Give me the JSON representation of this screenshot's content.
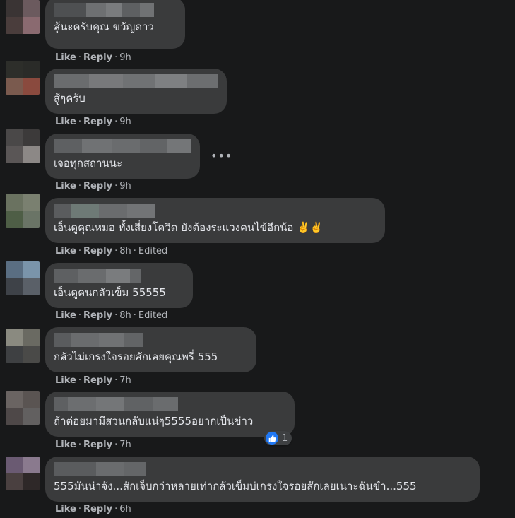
{
  "labels": {
    "like": "Like",
    "reply": "Reply",
    "separator": "·",
    "edited": "Edited"
  },
  "comments": [
    {
      "text": "สู้นะครับคุณ ขวัญดาว",
      "time": "9h",
      "edited": false,
      "avatar_colors": [
        "#3a3434",
        "#6b5a5e",
        "#4a3d3c",
        "#8a6a70"
      ],
      "name_blur_colors": [
        "#5a5c5e",
        "#6e7072",
        "#7a7c7e",
        "#5e6062",
        "#707274"
      ]
    },
    {
      "text": "สู้ๆครับ",
      "time": "9h",
      "edited": false,
      "avatar_colors": [
        "#2d2e2a",
        "#2a2b28",
        "#7a5a4e",
        "#8a4a3e"
      ],
      "name_blur_colors": [
        "#6a6c6e",
        "#78797b",
        "#707274",
        "#7e8082",
        "#6c6e70"
      ]
    },
    {
      "text": "เจอทุกสถานนะ",
      "time": "9h",
      "edited": false,
      "avatar_colors": [
        "#4a4848",
        "#3c3a3a",
        "#5a5656",
        "#8c8886"
      ],
      "name_blur_colors": [
        "#5e6062",
        "#707274",
        "#6a6c6e",
        "#626466",
        "#747678"
      ]
    },
    {
      "text": "เอ็นดูคุณหมอ ทั้งเสี่ยงโควิด ยังต้องระแวงคนไข้อีกน้อ ✌️✌️",
      "time": "8h",
      "edited": true,
      "avatar_colors": [
        "#6a7260",
        "#7a8070",
        "#4e5e46",
        "#6a7466"
      ],
      "name_blur_colors": [
        "#5a5c5e",
        "#6e7a76",
        "#6a6c6e",
        "#727476"
      ]
    },
    {
      "text": "เอ็นดูคนกลัวเข็ม 55555",
      "time": "8h",
      "edited": true,
      "avatar_colors": [
        "#5a6e82",
        "#7a94aa",
        "#3e4248",
        "#5a6068"
      ],
      "name_blur_colors": [
        "#5e6062",
        "#6a6c6e",
        "#7a7c7e",
        "#646668"
      ]
    },
    {
      "text": "กลัวไม่เกรงใจรอยสักเลยคุณพรี่ 555",
      "time": "7h",
      "edited": false,
      "avatar_colors": [
        "#8a8a80",
        "#6a6a62",
        "#3e4042",
        "#4a4a48"
      ],
      "name_blur_colors": [
        "#5a5c5e",
        "#6a6c6e",
        "#707274",
        "#626466"
      ]
    },
    {
      "text": "ถ้าต่อยมามีสวนกลับแน่ๆ5555อยากเป็นข่าว",
      "time": "7h",
      "edited": false,
      "avatar_colors": [
        "#6a6462",
        "#5a5452",
        "#4e4848",
        "#626060"
      ],
      "name_blur_colors": [
        "#5e6062",
        "#6c6e70",
        "#747678",
        "#606264",
        "#6a6c6e"
      ],
      "reaction_count": "1"
    },
    {
      "text": "555มันน่าจัง...สักเจ็บกว่าหลายเท่ากลัวเข็มบ่เกรงใจรอยสักเลยเนาะฉันขำ...555",
      "time": "6h",
      "edited": false,
      "avatar_colors": [
        "#6a5a72",
        "#8a7a8e",
        "#4a4040",
        "#2e2828"
      ],
      "name_blur_colors": [
        "#5a5c5e",
        "#6a6c6e",
        "#646668"
      ]
    }
  ]
}
